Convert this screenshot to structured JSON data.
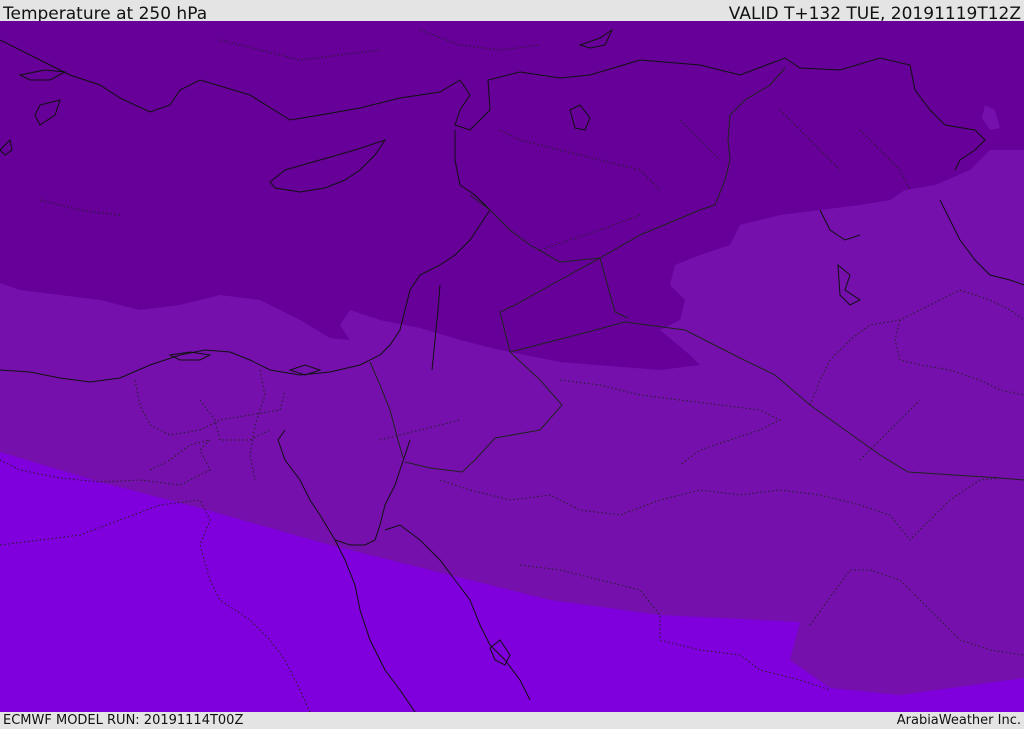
{
  "header": {
    "title": "Temperature at 250 hPa",
    "valid": "VALID T+132 TUE, 20191119T12Z"
  },
  "footer": {
    "model_run": "ECMWF MODEL RUN: 20191114T00Z",
    "brand": "ArabiaWeather Inc."
  },
  "colors": {
    "band_cold": "#660099",
    "band_mid": "#7510ad",
    "band_warm": "#7f00dc",
    "coastline": "#111111",
    "border": "#222222"
  }
}
